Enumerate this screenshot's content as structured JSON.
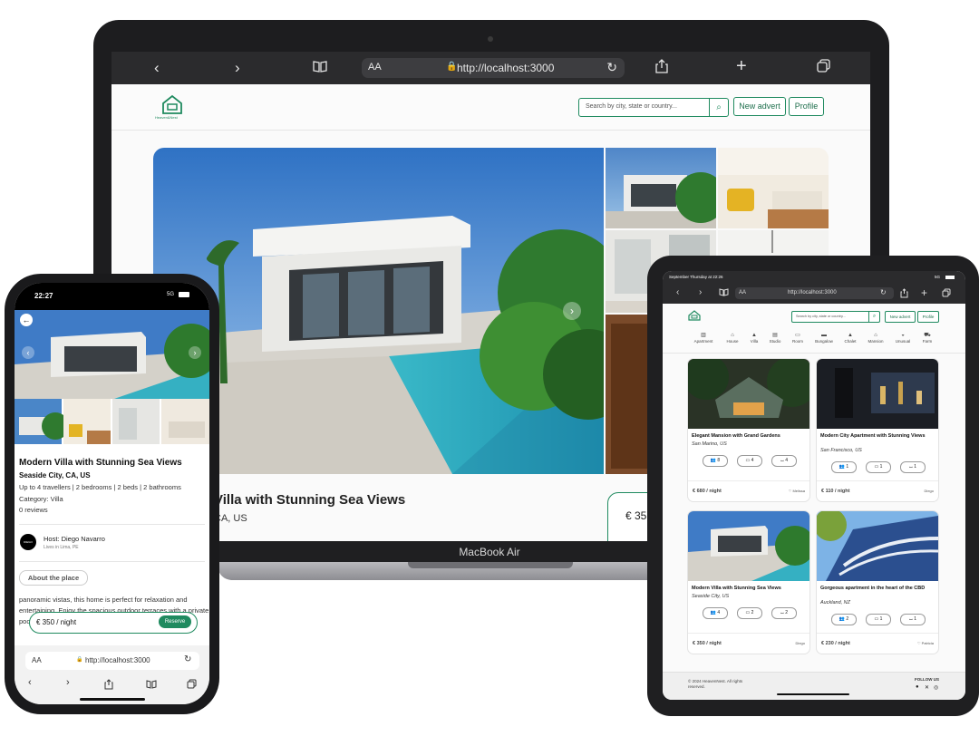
{
  "laptop": {
    "url": "http://localhost:3000",
    "aa_label": "AA",
    "search_placeholder": "Search by city, state or country...",
    "new_advert_label": "New advert",
    "profile_label": "Profile",
    "logo_text": "Heaven&Nest",
    "listing_title": "Villa with Stunning Sea Views",
    "listing_location": "CA, US",
    "price_partial": "€ 35",
    "device_name": "MacBook Air"
  },
  "phone": {
    "time": "22:27",
    "signal": "5G",
    "title": "Modern Villa with Stunning Sea Views",
    "location": "Seaside City, CA, US",
    "capacity": "Up to 4 travellers | 2 bedrooms | 2 beds | 2 bathrooms",
    "category": "Category: Villa",
    "reviews": "0 reviews",
    "host_name": "Host: Diego Navarro",
    "host_location": "Lives in Lima, PE",
    "avatar_text": "DIEGO NAVARRO",
    "about_label": "About the place",
    "description": "panoramic vistas, this home is perfect for relaxation and entertaining. Enjoy the spacious outdoor terraces with a private pool and direct access to the sandy beach.",
    "price": "€ 350 / night",
    "reserve_label": "Reserve",
    "url": "http://localhost:3000",
    "aa_label": "AA"
  },
  "tablet": {
    "status_time": "September Thursday at 22:26",
    "signal": "5G",
    "url": "http://localhost:3000",
    "aa_label": "AA",
    "search_placeholder": "Search by city, state or country...",
    "new_advert_label": "New advert",
    "profile_label": "Profile",
    "categories": [
      "Apartment",
      "House",
      "Villa",
      "Studio",
      "Room",
      "Bungalow",
      "Chalet",
      "Mansion",
      "Unusual",
      "Farm"
    ],
    "cards": [
      {
        "title": "Elegant Mansion with Grand Gardens",
        "location": "San Marino, US",
        "travellers": "8",
        "beds": "4",
        "baths": "4",
        "price": "€ 680 / night",
        "owner": "Melissa"
      },
      {
        "title": "Modern City Apartment with Stunning Views",
        "location": "San Francisco, US",
        "travellers": "1",
        "beds": "1",
        "baths": "1",
        "price": "€ 110 / night",
        "owner": "Diego"
      },
      {
        "title": "Modern Villa with Stunning Sea Views",
        "location": "Seaside City, US",
        "travellers": "4",
        "beds": "2",
        "baths": "2",
        "price": "€ 350 / night",
        "owner": "Diego"
      },
      {
        "title": "Gorgeous apartment in the heart of the CBD",
        "location": "Auckland, NZ",
        "travellers": "2",
        "beds": "1",
        "baths": "1",
        "price": "€ 230 / night",
        "owner": "Patricia"
      }
    ],
    "footer_copyright": "© 2024 HeavenNest. All rights reserved.",
    "follow_label": "FOLLOW US"
  }
}
